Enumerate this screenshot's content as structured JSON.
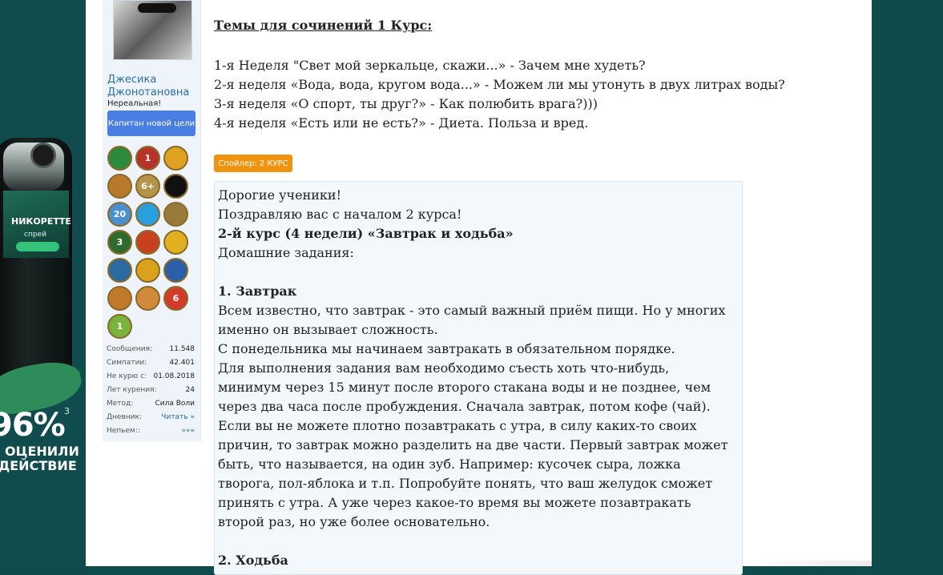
{
  "ad": {
    "brand": "НИКОРЕТТЕ",
    "brand_sub": "спрей",
    "percent": "96%",
    "footnote": "3",
    "line1": "ОЦЕНИЛИ",
    "line2": "ДЕЙСТВИЕ"
  },
  "user": {
    "name": "Джесика Джонотановна",
    "title": "Нереальная!",
    "banner": "Капитан новой цели",
    "badges": [
      {
        "icon": "trophy-badge-icon",
        "label": "",
        "color": "#2c8a3c"
      },
      {
        "icon": "plate-badge-icon",
        "label": "1",
        "color": "#b8322a"
      },
      {
        "icon": "flower-badge-icon",
        "label": "",
        "color": "#e0a020"
      },
      {
        "icon": "book-badge-icon",
        "label": "",
        "color": "#b87a2a"
      },
      {
        "icon": "diamond-badge-icon",
        "label": "6+",
        "color": "#b4934a"
      },
      {
        "icon": "butterfly-badge-icon",
        "label": "",
        "color": "#111111"
      },
      {
        "icon": "twenty-badge-icon",
        "label": "20",
        "color": "#4a90d0"
      },
      {
        "icon": "telegram-badge-icon",
        "label": "",
        "color": "#2a9fe0"
      },
      {
        "icon": "cup-badge-icon",
        "label": "",
        "color": "#9a7a3a"
      },
      {
        "icon": "compass-badge-icon",
        "label": "3",
        "color": "#2f6a2f"
      },
      {
        "icon": "stars-badge-icon",
        "label": "",
        "color": "#c8401e"
      },
      {
        "icon": "chef-badge-icon",
        "label": "",
        "color": "#e0b020"
      },
      {
        "icon": "open-book-badge-icon",
        "label": "",
        "color": "#2a6aa0"
      },
      {
        "icon": "star-box-badge-icon",
        "label": "",
        "color": "#d9a11c"
      },
      {
        "icon": "people-badge-icon",
        "label": "",
        "color": "#2b5fa8"
      },
      {
        "icon": "runner-badge-icon",
        "label": "",
        "color": "#c07a2a"
      },
      {
        "icon": "group-badge-icon",
        "label": "",
        "color": "#d08a3a"
      },
      {
        "icon": "tomato-badge-icon",
        "label": "6",
        "color": "#d23a2a"
      },
      {
        "icon": "snake-badge-icon",
        "label": "1",
        "color": "#7ab33a"
      }
    ],
    "stats": [
      {
        "key": "Сообщения:",
        "value": "11.548",
        "link": false
      },
      {
        "key": "Симпатии:",
        "value": "42.401",
        "link": false
      },
      {
        "key": "Не курю с:",
        "value": "01.08.2018",
        "link": false
      },
      {
        "key": "Лет курения:",
        "value": "24",
        "link": false
      },
      {
        "key": "Метод:",
        "value": "Сила Воли",
        "link": false
      },
      {
        "key": "Дневник:",
        "value": "Читать »",
        "link": true
      },
      {
        "key": "Непьем::",
        "value": "»»»",
        "link": true
      }
    ]
  },
  "post": {
    "topics_title": "Темы для сочинений 1 Курс:",
    "topics": [
      "1-я Неделя \"Свет мой зеркальце, скажи...» - Зачем мне худеть?",
      "2-я неделя «Вода, вода, кругом вода...» - Можем ли мы утонуть в двух литрах воды?",
      "3-я неделя «О спорт, ты друг?» - Как полюбить врага?)))",
      "4-я неделя «Есть или не есть?» - Диета. Польза и вред."
    ],
    "spoiler_label": "Спойлер: 2 КУРС",
    "spoiler": {
      "greeting": "Дорогие ученики!",
      "congrats": "Поздравляю вас с началом 2 курса!",
      "course_title": "2-й курс (4 недели) «Завтрак и ходьба»",
      "homework": "Домашние задания:",
      "s1_title": "1. Завтрак",
      "p1_l1": "Всем известно, что завтрак - это самый важный приём пищи. Но у многих",
      "p1_l2": "именно он вызывает сложность.",
      "p2": "С понедельника мы начинаем завтракать в обязательном порядке.",
      "p3_l1": "Для выполнения задания вам необходимо съесть хоть что-нибудь,",
      "p3_l2": "минимум через 15 минут после второго стакана воды и не позднее, чем",
      "p3_l3": "через два часа после пробуждения. Сначала завтрак, потом кофе (чай).",
      "p4_l1": "Если вы не можете плотно позавтракать с утра, в силу каких-то своих",
      "p4_l2": "причин, то завтрак можно разделить на две части. Первый завтрак может",
      "p4_l3": "быть, что называется, на один зуб. Например: кусочек сыра, ложка",
      "p4_l4": "творога, пол-яблока и т.п. Попробуйте понять, что ваш желудок сможет",
      "p4_l5": "принять с утра. А уже через какое-то время вы можете позавтракать",
      "p4_l6": "второй раз, но уже более основательно.",
      "s2_title": "2. Ходьба"
    }
  }
}
